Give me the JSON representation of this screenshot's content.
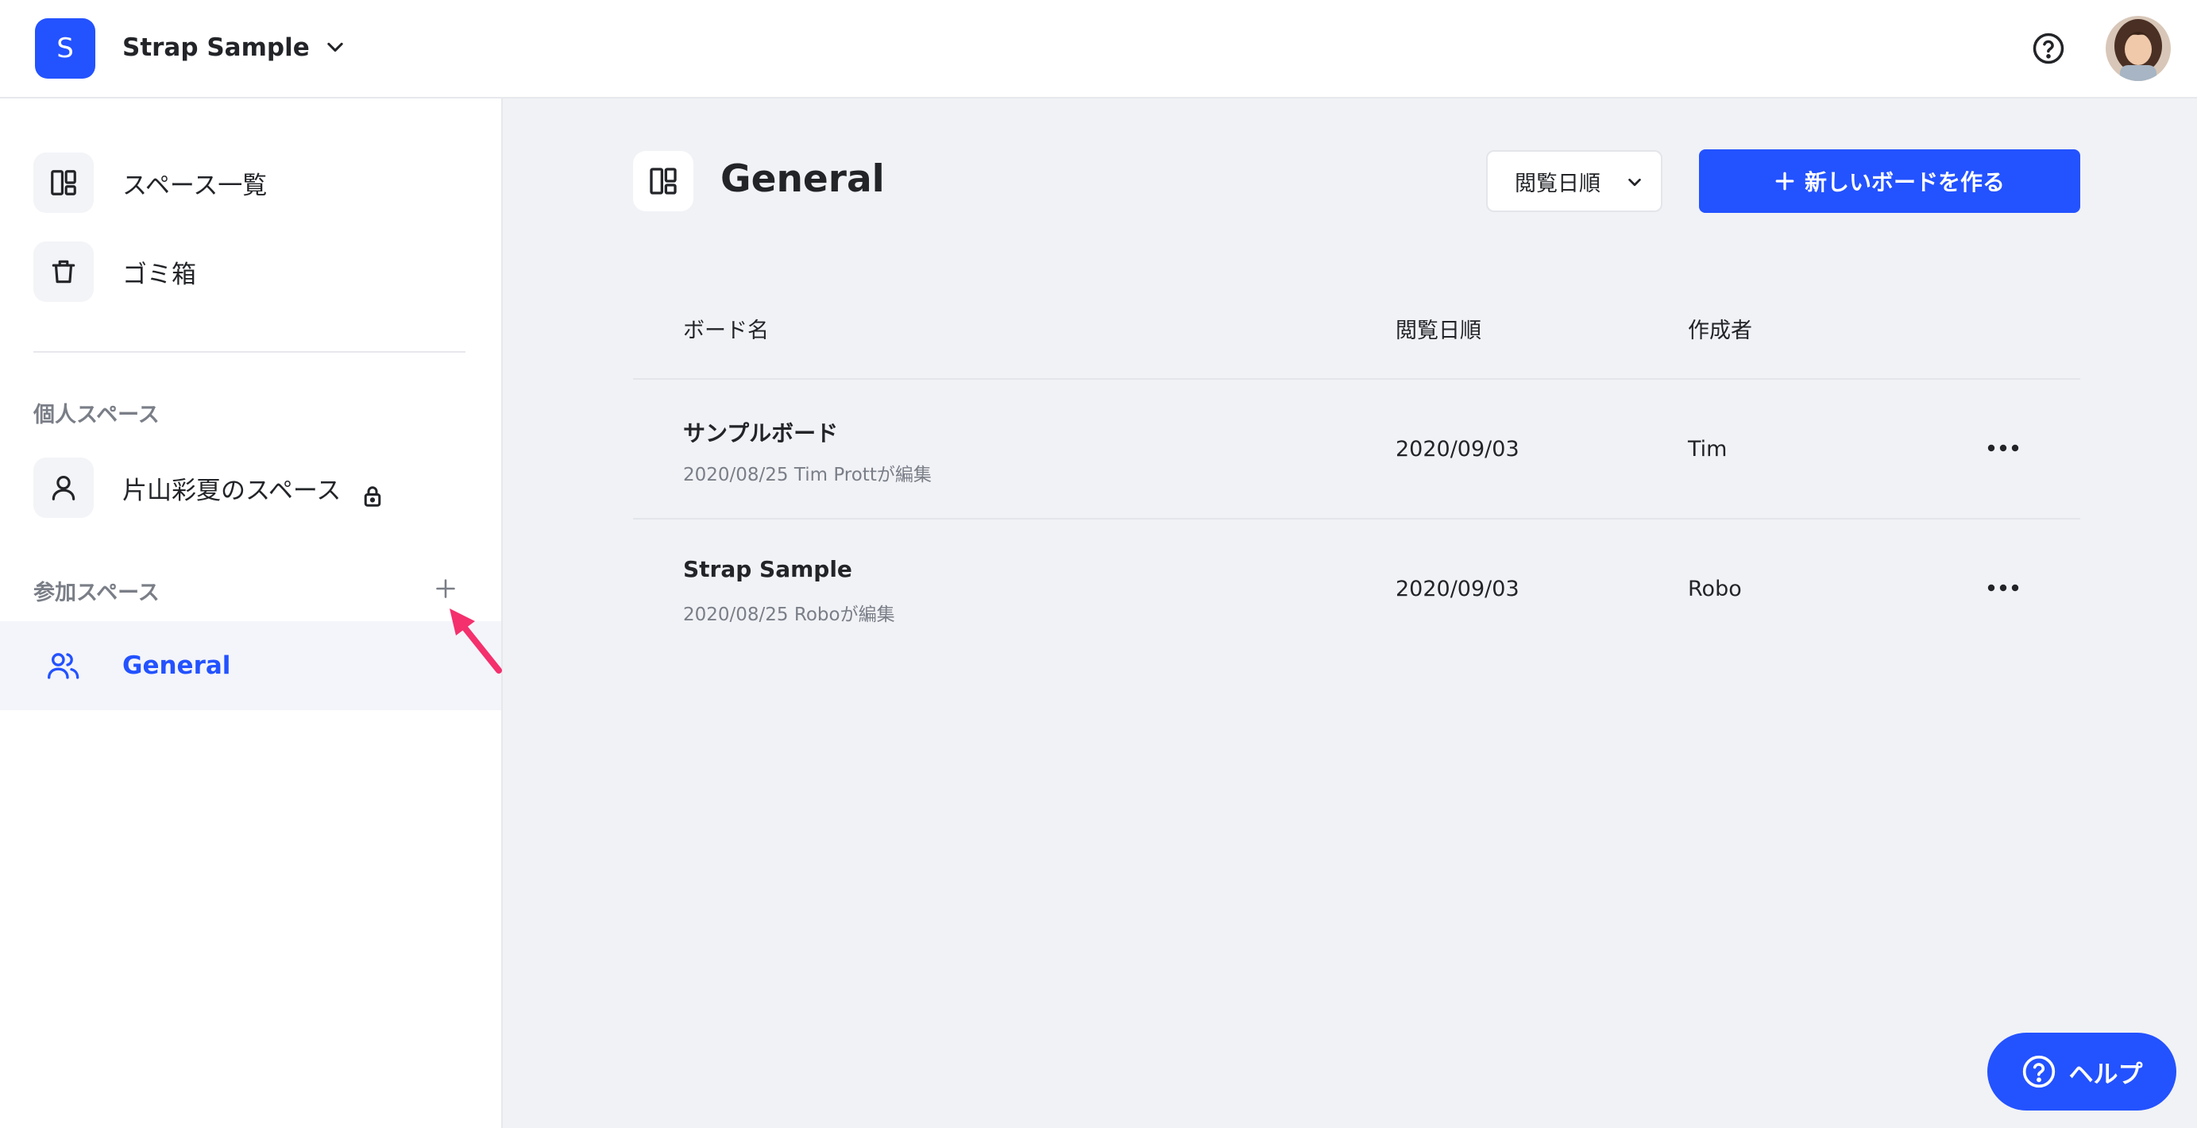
{
  "header": {
    "workspace_initial": "S",
    "workspace_name": "Strap Sample"
  },
  "sidebar": {
    "items": [
      {
        "label": "スペース一覧",
        "icon": "layout-icon"
      },
      {
        "label": "ゴミ箱",
        "icon": "trash-icon"
      }
    ],
    "personal_section_title": "個人スペース",
    "personal_space": {
      "label": "片山彩夏のスペース",
      "icon": "user-icon",
      "locked": true
    },
    "joined_section_title": "参加スペース",
    "joined_spaces": [
      {
        "label": "General",
        "icon": "users-icon",
        "active": true
      }
    ]
  },
  "main": {
    "title": "General",
    "sort_select": {
      "selected": "閲覧日順"
    },
    "new_board_label": "新しいボードを作る",
    "table": {
      "headers": [
        "ボード名",
        "閲覧日順",
        "作成者"
      ],
      "rows": [
        {
          "name": "サンプルボード",
          "meta": "2020/08/25 Tim Prottが編集",
          "date": "2020/09/03",
          "author": "Tim"
        },
        {
          "name": "Strap Sample",
          "meta": "2020/08/25 Roboが編集",
          "date": "2020/09/03",
          "author": "Robo"
        }
      ]
    },
    "help_label": "ヘルプ"
  },
  "colors": {
    "accent": "#2352ff",
    "main_bg": "#f1f2f6",
    "annotation_arrow": "#f4306d"
  }
}
